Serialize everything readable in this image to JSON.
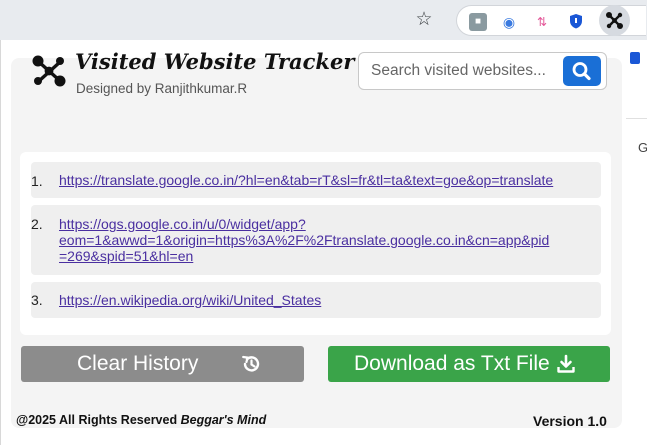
{
  "app": {
    "title": "Visited Website Tracker",
    "subtitle": "Designed by Ranjithkumar.R",
    "logo_icon": "network-nodes-icon"
  },
  "search": {
    "placeholder": "Search visited websites...",
    "value": "",
    "icon": "search-icon"
  },
  "history": {
    "items": [
      {
        "index": "1.",
        "url_lines": [
          "https://translate.google.co.in/?hl=en&tab=rT&sl=fr&tl=ta&text=goe&op=translate"
        ]
      },
      {
        "index": "2.",
        "url_lines": [
          "https://ogs.google.co.in/u/0/widget/app?",
          "eom=1&awwd=1&origin=https%3A%2F%2Ftranslate.google.co.in&cn=app&pid",
          "=269&spid=51&hl=en"
        ]
      },
      {
        "index": "3.",
        "url_lines": [
          "https://en.wikipedia.org/wiki/United_States"
        ]
      }
    ]
  },
  "buttons": {
    "clear": {
      "label": "Clear History",
      "icon": "history-icon"
    },
    "download": {
      "label": "Download as Txt File",
      "icon": "download-icon"
    }
  },
  "footer": {
    "copyright": "@2025 All Rights Reserved",
    "brand": "Beggar's Mind",
    "version": "Version 1.0"
  },
  "browser": {
    "star_icon": "☆",
    "ext_icons": [
      "gray-extension-icon",
      "globe-search-icon",
      "arrows-updown-icon",
      "shield-icon",
      "network-nodes-icon"
    ]
  },
  "page_sliver": {
    "letter": "G"
  },
  "colors": {
    "search_button": "#1a6fd6",
    "clear_button": "#8c8c8c",
    "download_button": "#3aa449",
    "link": "#4a2fa0"
  }
}
